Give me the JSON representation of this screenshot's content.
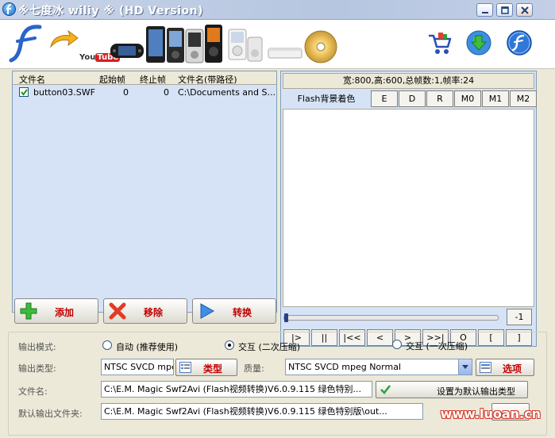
{
  "window": {
    "title": "※七度冰  wiliy ※ (HD Version)",
    "accent": "#0a246a"
  },
  "toolbar": {
    "icons": [
      "flash-logo-icon",
      "arrow-icon",
      "youtube-icon",
      "psp-icon",
      "phones-icon",
      "walkman-icon",
      "ipod-icon",
      "appletv-icon",
      "dvd-disc-icon",
      "cart-icon",
      "download-globe-icon",
      "flash-circle-icon"
    ],
    "youtube_label": "YouTube"
  },
  "filelist": {
    "columns": [
      "文件名",
      "起始帧",
      "终止帧",
      "文件名(带路径)"
    ],
    "rows": [
      {
        "checked": true,
        "name": "button03.SWF",
        "start": "0",
        "end": "0",
        "path": "C:\\Documents and S..."
      }
    ]
  },
  "preview": {
    "info": "宽:800,高:600,总帧数:1,帧率:24",
    "bg_label": "Flash背景着色",
    "mode_buttons": [
      "E",
      "D",
      "R",
      "M0",
      "M1",
      "M2"
    ],
    "frame_count": "-1",
    "progress": 0,
    "playback_buttons": [
      "|>",
      "||",
      "|<<",
      "<",
      ">",
      ">>|",
      "O",
      "[",
      "]"
    ]
  },
  "actions": {
    "add": "添加",
    "remove": "移除",
    "convert": "转换"
  },
  "settings": {
    "output_mode_label": "输出模式:",
    "mode_auto": "自动 (推荐使用)",
    "mode_interactive2": "交互 (二次压缩)",
    "mode_interactive1": "交互 (一次压缩)",
    "selected_mode": "mode_interactive2",
    "output_type_label": "输出类型:",
    "output_type_value": "NTSC SVCD mpeg Normal",
    "type_button": "类型",
    "quality_label": "质量:",
    "quality_value": "NTSC SVCD mpeg Normal",
    "options_button": "选项",
    "filename_label": "文件名:",
    "filename_value": "C:\\E.M. Magic Swf2Avi (Flash视频转换)V6.0.9.115 绿色特别...",
    "set_default_button": "设置为默认输出类型",
    "default_folder_label": "默认输出文件夹:",
    "default_folder_value": "C:\\E.M. Magic Swf2Avi (Flash视频转换)V6.0.9.115 绿色特别版\\out..."
  },
  "watermark": "www.luoan.cn"
}
